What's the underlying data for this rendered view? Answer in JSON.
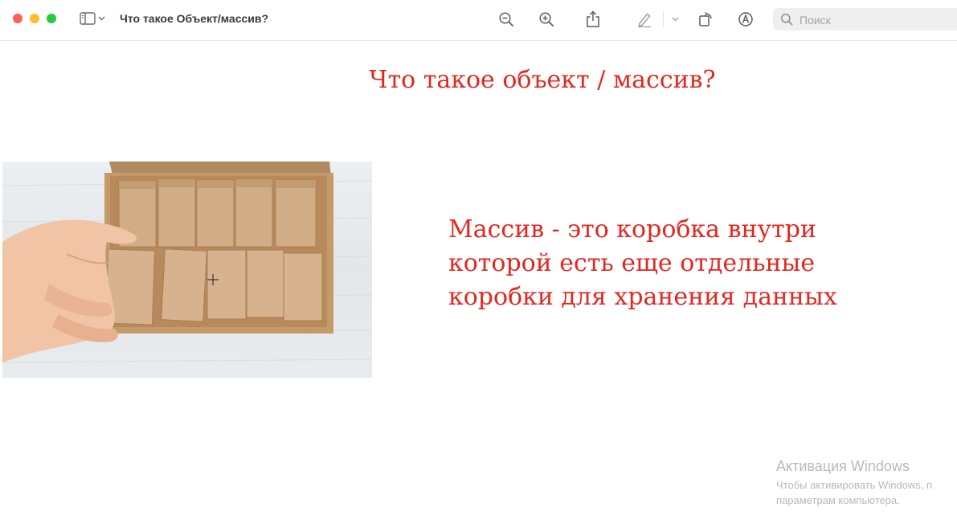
{
  "window": {
    "title": "Что такое Объект/массив?",
    "traffic_colors": {
      "close": "#fe5f57",
      "minimize": "#febc2e",
      "maximize": "#28c840"
    }
  },
  "toolbar": {
    "icons": [
      "sidebar-icon",
      "zoom-out-icon",
      "zoom-in-icon",
      "share-icon",
      "markup-pen-icon",
      "rotate-icon",
      "annotate-icon",
      "search-icon"
    ],
    "search_placeholder": "Поиск"
  },
  "slide": {
    "title": "Что такое объект / массив?",
    "body_lines": [
      "Массив - это коробка внутри",
      "которой есть еще отдельные",
      "коробки для хранения данных"
    ],
    "accent_color": "#e5261f"
  },
  "watermark": {
    "title": "Активация Windows",
    "line1": "Чтобы активировать Windows, п",
    "line2": "параметрам компьютера."
  }
}
